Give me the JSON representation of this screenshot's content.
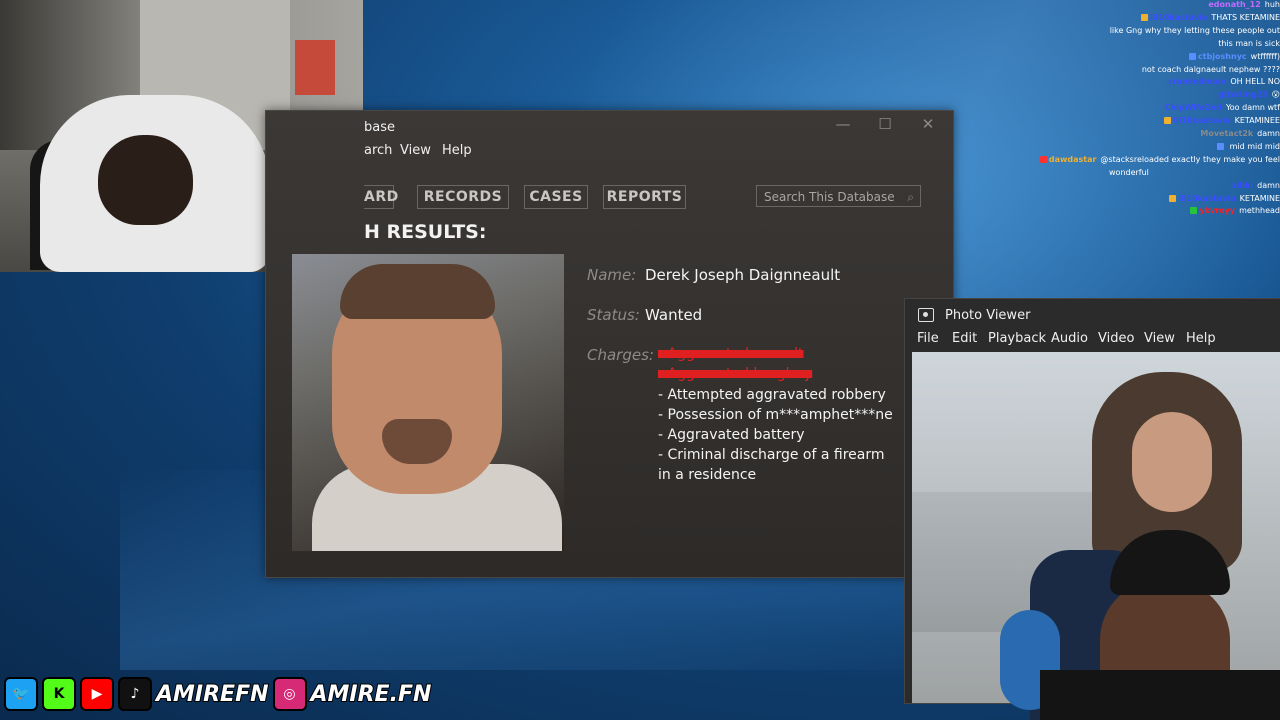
{
  "database_window": {
    "title": "base",
    "menu": [
      "arch",
      "View",
      "Help"
    ],
    "controls": [
      "—",
      "☐",
      "✕"
    ],
    "tabs": [
      "ARD",
      "RECORDS",
      "CASES",
      "REPORTS"
    ],
    "search_placeholder": "Search This Database",
    "results_heading": "H RESULTS:",
    "name_label": "Name:",
    "name_value": "Derek Joseph Daignneault",
    "status_label": "Status:",
    "status_value": "Wanted",
    "charges_label": "Charges:",
    "charges_redacted": [
      "- Aggravated assault",
      "- Aggravated burglary"
    ],
    "charges": [
      "- Attempted aggravated robbery",
      "- Possession of m***amphet***ne",
      "- Aggravated battery",
      "- Criminal discharge of a firearm",
      "in a residence"
    ]
  },
  "photo_viewer": {
    "title": "Photo Viewer",
    "menu": [
      "File",
      "Edit",
      "Playback",
      "Audio",
      "Video",
      "View",
      "Help"
    ]
  },
  "chat": [
    {
      "user": "edonath_12",
      "msg": "huh",
      "color": "#c06cff",
      "badge": ""
    },
    {
      "user": "lil10kastavia",
      "msg": "THATS KETAMINE",
      "color": "#3a4dff",
      "badge": "#f0b030"
    },
    {
      "user": "",
      "msg": "like Gng why they letting these people out",
      "color": "#ff2020",
      "badge": ""
    },
    {
      "user": "",
      "msg": "this man is sick",
      "color": "#26c43d",
      "badge": ""
    },
    {
      "user": "ctbjoshnyc",
      "msg": "wtffffff)",
      "color": "#5a8dff",
      "badge": "#5a8dff"
    },
    {
      "user": "",
      "msg": "not coach dalgnaeult nephew ????",
      "color": "#ff2020",
      "badge": ""
    },
    {
      "user": "crankedmain",
      "msg": "OH HELL NO",
      "color": "#3a4dff",
      "badge": ""
    },
    {
      "user": "gtbxting23",
      "msg": "😮",
      "color": "#3a4dff",
      "badge": ""
    },
    {
      "user": "ChipWife2nd",
      "msg": "Yoo damn wtf",
      "color": "#3a4dff",
      "badge": ""
    },
    {
      "user": "lil10kastavia",
      "msg": "KETAMINEE",
      "color": "#3a4dff",
      "badge": "#f0b030"
    },
    {
      "user": "Movetact2k",
      "msg": "damn",
      "color": "#8a8a8a",
      "badge": ""
    },
    {
      "user": "",
      "msg": "mid mid mid",
      "color": "#ff2020",
      "badge": "#5a8dff"
    },
    {
      "user": "dawdastar",
      "msg": "@stacksreloaded exactly they make you feel",
      "color": "#f0b030",
      "badge": "#ff3030"
    },
    {
      "user": "",
      "msg": "wonderful",
      "color": "#ffffff",
      "badge": ""
    },
    {
      "user": "zihki",
      "msg": "damn",
      "color": "#3a4dff",
      "badge": ""
    },
    {
      "user": "lil10kastavia",
      "msg": "KETAMINE",
      "color": "#3a4dff",
      "badge": "#f0b030"
    },
    {
      "user": "ykvroyy",
      "msg": "methhead",
      "color": "#ff2020",
      "badge": "#26c43d"
    }
  ],
  "socials": {
    "handle1": "AMIREFN",
    "handle2": "AMIRE.FN",
    "icons": [
      "twitter-icon",
      "kick-icon",
      "youtube-icon",
      "tiktok-icon",
      "instagram-icon"
    ],
    "icon_colors": {
      "twitter": "#1da1f2",
      "kick": "#53fc18",
      "youtube": "#ff0000",
      "tiktok": "#111111",
      "instagram": "#d62976"
    }
  }
}
